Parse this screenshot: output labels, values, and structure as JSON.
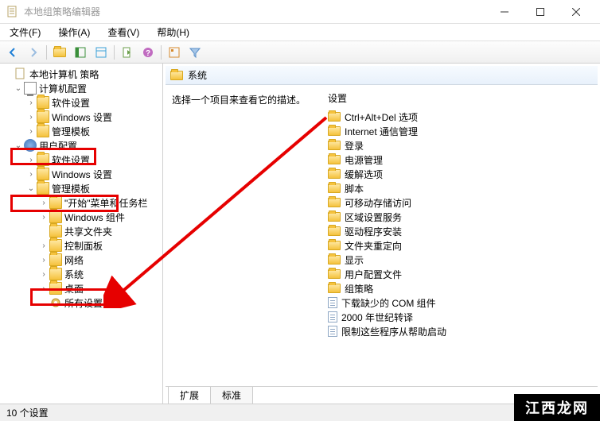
{
  "window": {
    "title": "本地组策略编辑器"
  },
  "menu": {
    "file": "文件(F)",
    "action": "操作(A)",
    "view": "查看(V)",
    "help": "帮助(H)"
  },
  "tree": {
    "root": "本地计算机 策略",
    "computer_config": "计算机配置",
    "cc_software": "软件设置",
    "cc_windows": "Windows 设置",
    "cc_templates": "管理模板",
    "user_config": "用户配置",
    "uc_software": "软件设置",
    "uc_windows": "Windows 设置",
    "uc_templates": "管理模板",
    "uc_start": "\"开始\"菜单和任务栏",
    "uc_wincomp": "Windows 组件",
    "uc_shared": "共享文件夹",
    "uc_control": "控制面板",
    "uc_network": "网络",
    "uc_system": "系统",
    "uc_desktop": "桌面",
    "uc_all": "所有设置"
  },
  "content": {
    "header": "系统",
    "description": "选择一个项目来查看它的描述。",
    "column": "设置",
    "items": [
      "Ctrl+Alt+Del 选项",
      "Internet 通信管理",
      "登录",
      "电源管理",
      "缓解选项",
      "脚本",
      "可移动存储访问",
      "区域设置服务",
      "驱动程序安装",
      "文件夹重定向",
      "显示",
      "用户配置文件",
      "组策略"
    ],
    "docitems": [
      "下载缺少的 COM 组件",
      "2000 年世纪转译",
      "限制这些程序从帮助启动"
    ]
  },
  "tabs": {
    "extended": "扩展",
    "standard": "标准"
  },
  "status": {
    "count": "10 个设置"
  },
  "watermark": "江西龙网"
}
